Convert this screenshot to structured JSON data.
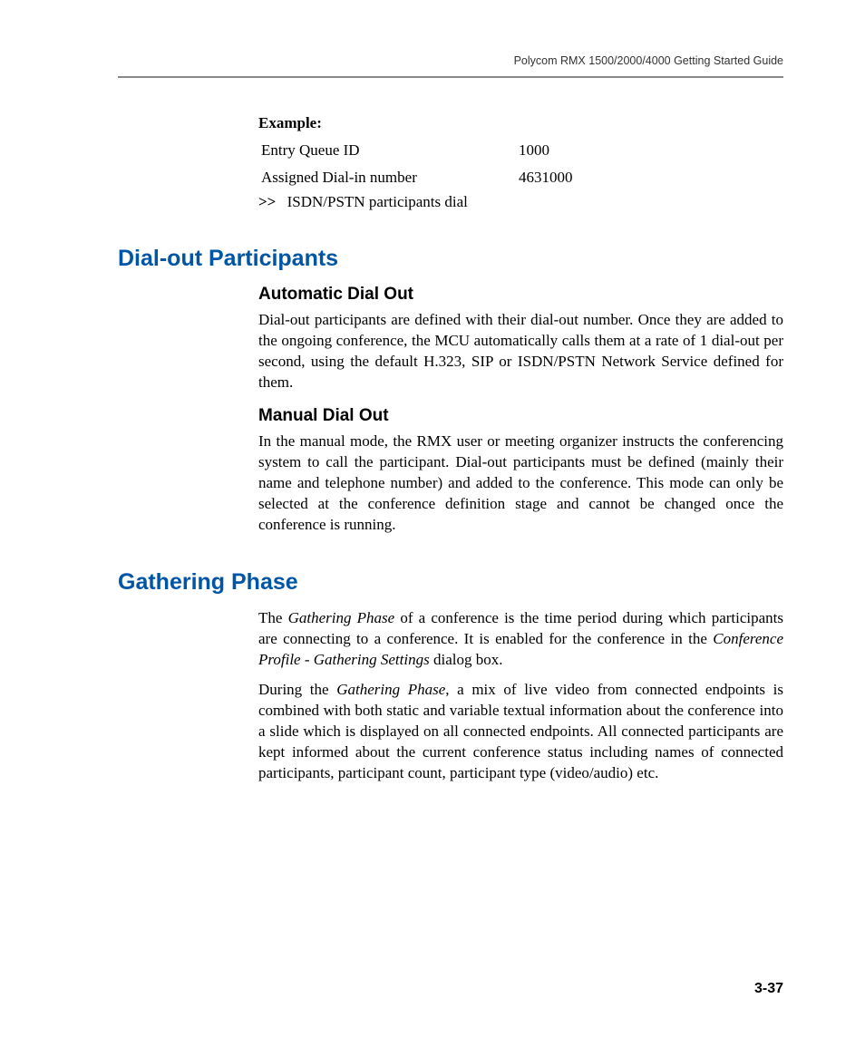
{
  "header": "Polycom RMX 1500/2000/4000 Getting Started Guide",
  "example": {
    "label": "Example:",
    "rows": [
      {
        "label": "Entry Queue ID",
        "value": "1000"
      },
      {
        "label": "Assigned Dial-in number",
        "value": "4631000"
      }
    ],
    "arrow": ">>",
    "dial_text": "ISDN/PSTN participants dial"
  },
  "section1": {
    "title": "Dial-out Participants",
    "sub1": {
      "title": "Automatic Dial Out",
      "body": "Dial-out participants are defined with their dial-out number. Once they are added to the ongoing conference, the MCU automatically calls them at a rate of 1 dial-out per second, using the default H.323, SIP or ISDN/PSTN Network Service defined for them."
    },
    "sub2": {
      "title": "Manual Dial Out",
      "body": "In the manual mode, the RMX user or meeting organizer instructs the conferencing system to call the participant. Dial-out participants must be defined (mainly their name and telephone number) and added to the conference. This mode can only be selected at the conference definition stage and cannot be changed once the conference is running."
    }
  },
  "section2": {
    "title": "Gathering Phase",
    "p1_a": "The ",
    "p1_it1": "Gathering Phase",
    "p1_b": " of a conference is the time period during which participants are connecting to a conference. It is enabled for the conference in the ",
    "p1_it2": "Conference Profile - Gathering Settings",
    "p1_c": " dialog box.",
    "p2_a": "During the ",
    "p2_it1": "Gathering Phase",
    "p2_b": ", a mix of live video from connected endpoints is combined with both static and variable textual information about the conference into a slide which is displayed on all connected endpoints. All connected participants are kept informed about the current conference status including names of connected participants, participant count, participant type (video/audio) etc."
  },
  "page_number": "3-37"
}
